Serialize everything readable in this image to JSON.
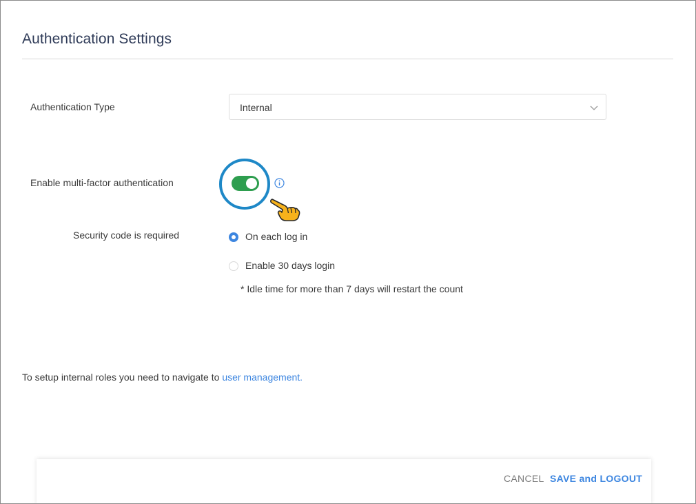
{
  "page": {
    "title": "Authentication Settings"
  },
  "auth_type": {
    "label": "Authentication Type",
    "selected": "Internal",
    "icon": "chevron-down-icon"
  },
  "mfa": {
    "label": "Enable multi-factor authentication",
    "enabled": true,
    "toggle_color": "#2e9e4f",
    "highlight_color": "#1e88c7",
    "info_icon": "info-icon",
    "pointer_icon": "pointing-hand-icon"
  },
  "security_code": {
    "label": "Security code is required",
    "options": [
      {
        "label": "On each log in",
        "selected": true
      },
      {
        "label": "Enable 30 days login",
        "selected": false
      }
    ],
    "note": "* Idle time for more than 7 days will restart the count"
  },
  "navigation_hint": {
    "text": "To setup internal roles you need to navigate to",
    "link_text": "user management."
  },
  "footer": {
    "cancel_label": "CANCEL",
    "save_label": "SAVE and LOGOUT"
  },
  "colors": {
    "accent": "#3d86e0",
    "title": "#2f3b58"
  }
}
